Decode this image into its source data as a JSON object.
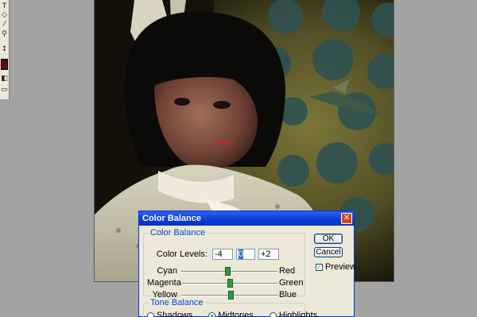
{
  "toolbar": {
    "tools": [
      {
        "icon": "type-tool-icon",
        "glyph": "T"
      },
      {
        "icon": "shape-tool-icon",
        "glyph": "◇"
      },
      {
        "icon": "eyedropper-icon",
        "glyph": "⁄"
      },
      {
        "icon": "zoom-icon",
        "glyph": "⚲"
      },
      {
        "icon": "swap-colors-icon",
        "glyph": "↕"
      },
      {
        "icon": "quick-mask-icon",
        "glyph": "◧"
      },
      {
        "icon": "screen-mode-icon",
        "glyph": "▭"
      }
    ],
    "foreground_color": "#5a0d0d"
  },
  "dialog": {
    "title": "Color Balance",
    "close_glyph": "✕",
    "color_balance": {
      "group_label": "Color Balance",
      "levels_label": "Color Levels:",
      "levels": [
        "-4",
        "0",
        "+2"
      ],
      "sliders": [
        {
          "left": "Cyan",
          "right": "Red",
          "value": -4
        },
        {
          "left": "Magenta",
          "right": "Green",
          "value": 0
        },
        {
          "left": "Yellow",
          "right": "Blue",
          "value": 2
        }
      ]
    },
    "tone_balance": {
      "group_label": "Tone Balance",
      "options": [
        {
          "label": "Shadows",
          "selected": false
        },
        {
          "label": "Midtones",
          "selected": true
        },
        {
          "label": "Highlights",
          "selected": false
        }
      ]
    },
    "ok_label": "OK",
    "cancel_label": "Cancel",
    "preview_label": "Preview",
    "preview_checked": true,
    "check_glyph": "✓"
  },
  "colors": {
    "titlebar": "#0a3bd4",
    "dialog_bg": "#ece9d8",
    "group_label": "#0046d5",
    "thumb": "#2f9a3c"
  }
}
